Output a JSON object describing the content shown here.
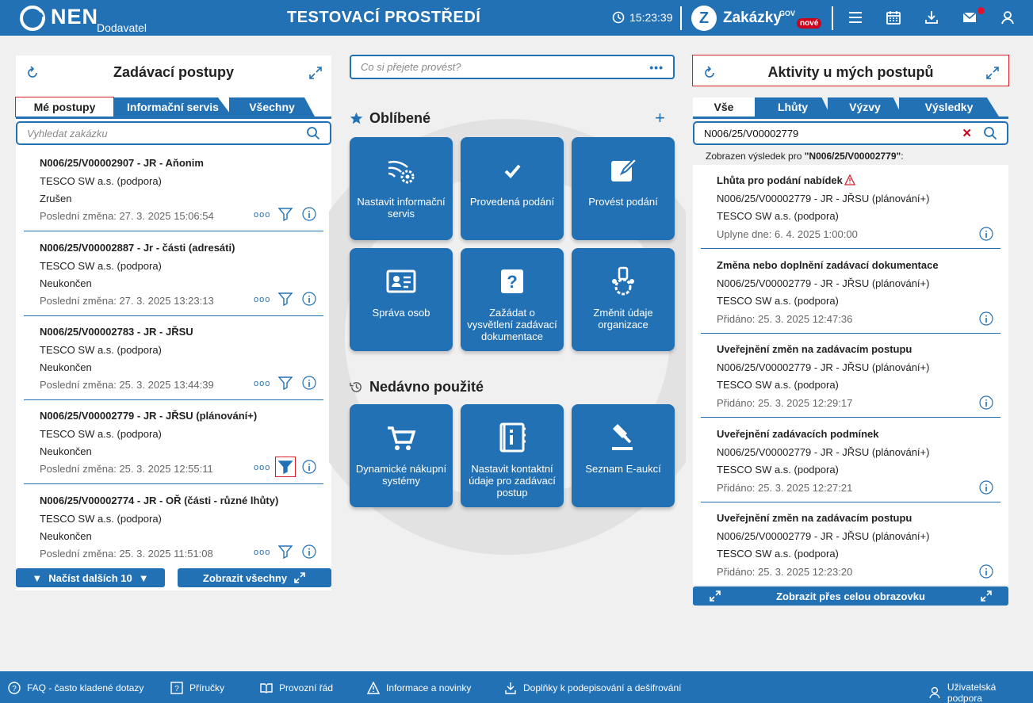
{
  "header": {
    "logo": "NEN",
    "logo_sub": "Dodavatel",
    "env_title": "TESTOVACÍ PROSTŘEDÍ",
    "time": "15:23:39",
    "zakazky": "Zakázky",
    "gov": "GOV",
    "nove": "nové"
  },
  "left": {
    "title": "Zadávací postupy",
    "tabs": [
      "Mé postupy",
      "Informační servis",
      "Všechny"
    ],
    "search_placeholder": "Vyhledat zakázku",
    "items": [
      {
        "title": "N006/25/V00002907 - JR - Aňonim",
        "org": "TESCO SW a.s. (podpora)",
        "state": "Zrušen",
        "changed": "Poslední změna: 27. 3. 2025 15:06:54"
      },
      {
        "title": "N006/25/V00002887 - Jr - části (adresáti)",
        "org": "TESCO SW a.s. (podpora)",
        "state": "Neukončen",
        "changed": "Poslední změna: 27. 3. 2025 13:23:13"
      },
      {
        "title": "N006/25/V00002783 - JR - JŘSU",
        "org": "TESCO SW a.s. (podpora)",
        "state": "Neukončen",
        "changed": "Poslední změna: 25. 3. 2025 13:44:39"
      },
      {
        "title": "N006/25/V00002779 - JR - JŘSU (plánování+)",
        "org": "TESCO SW a.s. (podpora)",
        "state": "Neukončen",
        "changed": "Poslední změna: 25. 3. 2025 12:55:11"
      },
      {
        "title": "N006/25/V00002774 - JR - OŘ (části - různé lhůty)",
        "org": "TESCO SW a.s. (podpora)",
        "state": "Neukončen",
        "changed": "Poslední změna: 25. 3. 2025 11:51:08"
      }
    ],
    "load_more": "Načíst dalších 10",
    "show_all": "Zobrazit všechny"
  },
  "center": {
    "search_placeholder": "Co si přejete provést?",
    "favorites": "Oblíbené",
    "recent": "Nedávno použité",
    "fav_tiles": [
      "Nastavit informační servis",
      "Provedená podání",
      "Provést podání",
      "Správa osob",
      "Zažádat o vysvětlení zadávací dokumentace",
      "Změnit údaje organizace"
    ],
    "recent_tiles": [
      "Dynamické nákupní systémy",
      "Nastavit kontaktní údaje pro zadávací postup",
      "Seznam E-aukcí"
    ]
  },
  "right": {
    "title": "Aktivity u mých postupů",
    "tabs": [
      "Vše",
      "Lhůty",
      "Výzvy",
      "Výsledky"
    ],
    "search_value": "N006/25/V00002779",
    "result_prefix": "Zobrazen výsledek pro ",
    "result_term": "\"N006/25/V00002779\"",
    "result_suffix": ":",
    "items": [
      {
        "title": "Lhůta pro podání nabídek",
        "ref": "N006/25/V00002779 - JR - JŘSU (plánování+)",
        "org": "TESCO SW a.s. (podpora)",
        "date": "Uplyne dne: 6. 4. 2025 1:00:00"
      },
      {
        "title": "Změna nebo doplnění zadávací dokumentace",
        "ref": "N006/25/V00002779 - JR - JŘSU (plánování+)",
        "org": "TESCO SW a.s. (podpora)",
        "date": "Přidáno: 25. 3. 2025 12:47:36"
      },
      {
        "title": "Uveřejnění změn na zadávacím postupu",
        "ref": "N006/25/V00002779 - JR - JŘSU (plánování+)",
        "org": "TESCO SW a.s. (podpora)",
        "date": "Přidáno: 25. 3. 2025 12:29:17"
      },
      {
        "title": "Uveřejnění zadávacích podmínek",
        "ref": "N006/25/V00002779 - JR - JŘSU (plánování+)",
        "org": "TESCO SW a.s. (podpora)",
        "date": "Přidáno: 25. 3. 2025 12:27:21"
      },
      {
        "title": "Uveřejnění změn na zadávacím postupu",
        "ref": "N006/25/V00002779 - JR - JŘSU (plánování+)",
        "org": "TESCO SW a.s. (podpora)",
        "date": "Přidáno: 25. 3. 2025 12:23:20"
      }
    ],
    "fullscreen": "Zobrazit přes celou obrazovku"
  },
  "footer": {
    "faq": "FAQ - často kladené dotazy",
    "manual": "Příručky",
    "rules": "Provozní řád",
    "news": "Informace a novinky",
    "addons": "Doplňky k podepisování a dešifrování",
    "support": "Uživatelská podpora"
  }
}
